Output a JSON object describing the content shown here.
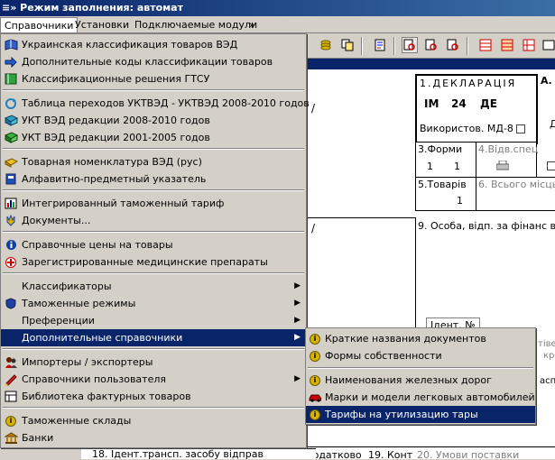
{
  "window": {
    "title": "≡» Режим заполнения: автомат"
  },
  "menubar": {
    "items": [
      "Справочники",
      "Установки",
      "Подключаемые модули",
      "»"
    ]
  },
  "menu": {
    "items": [
      {
        "label": "Украинская классификация товаров ВЭД",
        "icon": "book-icon",
        "arrow": ""
      },
      {
        "label": "Дополнительные коды классификации товаров",
        "icon": "arrow-right-icon",
        "arrow": ""
      },
      {
        "label": "Классификационные решения ГТСУ",
        "icon": "green-book-icon",
        "arrow": ""
      },
      {
        "label": "Таблица переходов УКТВЭД - УКТВЭД 2008-2010 годов",
        "icon": "refresh-icon",
        "arrow": ""
      },
      {
        "label": "УКТ ВЭД редакции 2008-2010 годов",
        "icon": "blue-book-icon",
        "arrow": ""
      },
      {
        "label": "УКТ ВЭД редакции 2001-2005 годов",
        "icon": "green-book-icon",
        "arrow": ""
      },
      {
        "label": "Товарная номенклатура ВЭД (рус)",
        "icon": "yellow-book-icon",
        "arrow": ""
      },
      {
        "label": "Алфавитно-предметный указатель",
        "icon": "index-book-icon",
        "arrow": ""
      },
      {
        "label": "Интегрированный таможенный тариф",
        "icon": "chart-icon",
        "arrow": ""
      },
      {
        "label": "Документы...",
        "icon": "trident-icon",
        "arrow": ""
      },
      {
        "label": "Справочные цены на товары",
        "icon": "info-icon",
        "arrow": ""
      },
      {
        "label": "Зарегистрированные медицинские препараты",
        "icon": "medical-icon",
        "arrow": ""
      },
      {
        "label": "Классификаторы",
        "icon": "",
        "arrow": "▶"
      },
      {
        "label": "Таможенные режимы",
        "icon": "shield-icon",
        "arrow": "▶"
      },
      {
        "label": "Преференции",
        "icon": "",
        "arrow": "▶"
      },
      {
        "label": "Дополнительные справочники",
        "icon": "",
        "arrow": "▶"
      },
      {
        "label": "Импортеры / экспортеры",
        "icon": "people-icon",
        "arrow": ""
      },
      {
        "label": "Справочники пользователя",
        "icon": "user-book-icon",
        "arrow": "▶"
      },
      {
        "label": "Библиотека фактурных товаров",
        "icon": "library-icon",
        "arrow": ""
      },
      {
        "label": "Таможенные склады",
        "icon": "coin-icon",
        "arrow": ""
      },
      {
        "label": "Банки",
        "icon": "bank-icon",
        "arrow": ""
      }
    ]
  },
  "submenu": {
    "items": [
      {
        "label": "Краткие названия документов",
        "icon": "coin-icon"
      },
      {
        "label": "Формы собственности",
        "icon": "coin-icon"
      },
      {
        "label": "Наименования железных дорог",
        "icon": "coin-icon"
      },
      {
        "label": "Марки и модели легковых автомобилей",
        "icon": "car-icon"
      },
      {
        "label": "Тарифы на утилизацию тары",
        "icon": "coin-icon"
      }
    ]
  },
  "document": {
    "decl_label": "1.ДЕКЛАРАЦІЯ",
    "decl_codes": [
      "ІМ",
      "24",
      "ДЕ"
    ],
    "md8_label": "Використов. МД-8",
    "forms_label": "3.Форми",
    "forms_values": [
      "1",
      "1"
    ],
    "spec_label": "4.Відв.спец",
    "goods_label": "5.Товарів",
    "goods_value": "1",
    "places_label": "6. Всього місць",
    "person_label": "9. Особа, відп. за фінанс в",
    "ident_label": "Ідент. №",
    "transport_label": "18. Ідент.трансп. засобу відправ",
    "add_label": "Додатково",
    "cont_label": "19. Конт",
    "delivery_label": "20. Умови поставки",
    "side_a": "А.",
    "side_d": "Д",
    "side_kp": "кр",
    "side_tiv": "тівел",
    "side_asp": "аспо",
    "slash": "/"
  }
}
